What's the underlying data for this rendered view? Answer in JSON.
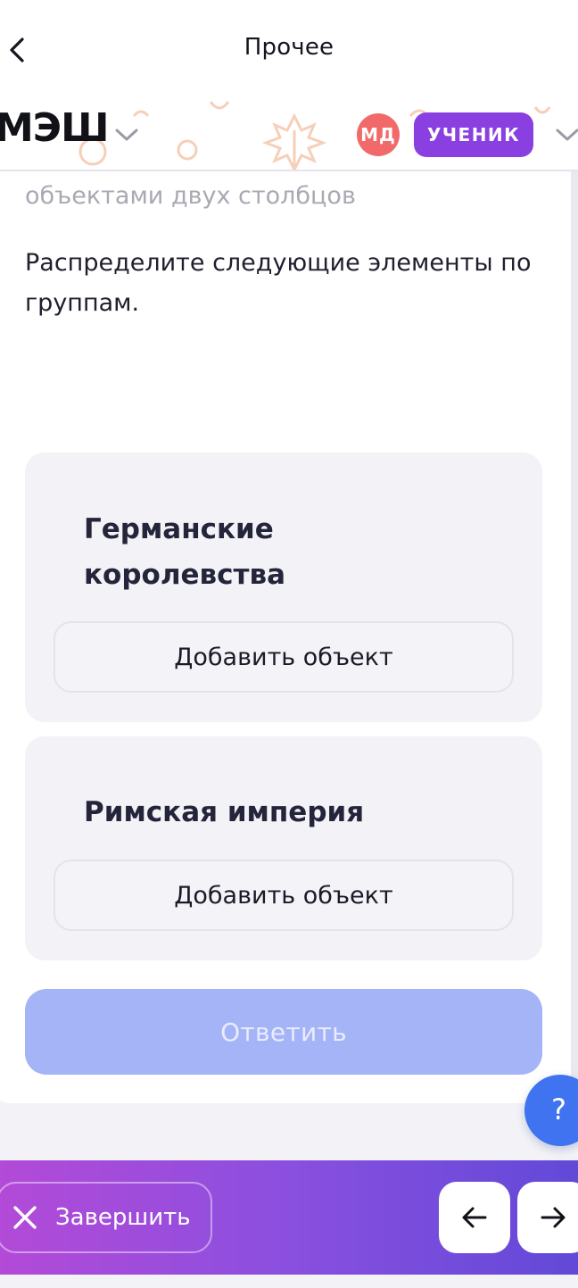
{
  "topbar": {
    "title": "Прочее"
  },
  "header": {
    "logo": "МЭШ",
    "avatar_initials": "МД",
    "role": "УЧЕНИК"
  },
  "task": {
    "hint": "объектами двух столбцов",
    "instruction": "Распределите следующие элементы по группам."
  },
  "groups": [
    {
      "title": "Германские королевства",
      "add_label": "Добавить объект"
    },
    {
      "title": "Римская империя",
      "add_label": "Добавить объект"
    }
  ],
  "answer_label": "Ответить",
  "help_label": "?",
  "bottombar": {
    "finish_label": "Завершить"
  },
  "colors": {
    "accent_purple": "#8a3fe0",
    "avatar_red": "#f2696a",
    "answer_disabled": "#a5b4f6",
    "help_blue": "#3f73f0"
  },
  "icons": {
    "back": "chevron-left-icon",
    "finish": "close-icon",
    "prev": "arrow-left-icon",
    "next": "arrow-right-icon"
  }
}
